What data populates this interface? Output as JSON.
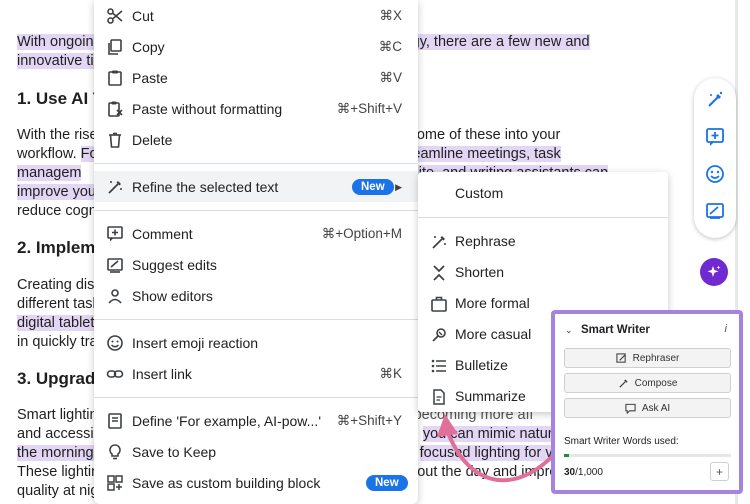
{
  "doc": {
    "line1a": "With ongoing",
    "line1b": "gy, there are a few new and",
    "line2": "innovative tip",
    "h1": "1. Use AI T",
    "p1_1a": "With the rise",
    "p1_1b": "some of these into your",
    "p1_2a": "workflow. ",
    "p1_2b": "Fo",
    "p1_2c": "reamline meetings, task",
    "p1_3a": "managem",
    "p1_3b": "site, and writing assistants can",
    "p1_4a": "improve you",
    "p1_5": "reduce cogn",
    "h2": "2. Impleme",
    "p2_1": "Creating dist",
    "p2_2": "different task",
    "p2_3": "digital tablet)",
    "p2_4": "in quickly tra",
    "h3": "3. Upgrad",
    "p3_1a": "Smart lightin",
    "p3_1b": "becoming more aff",
    "p3_2a": "and accessibl",
    "p3_2b": "you can mimic natural",
    "p3_3a": "the morning,",
    "p3_3b": "focused lighting for vid",
    "p3_4a": "These lightin",
    "p3_4b": "out the day and impro",
    "p3_5": "quality at nig"
  },
  "menu": {
    "cut": {
      "label": "Cut",
      "shortcut": "⌘X"
    },
    "copy": {
      "label": "Copy",
      "shortcut": "⌘C"
    },
    "paste": {
      "label": "Paste",
      "shortcut": "⌘V"
    },
    "paste_plain": {
      "label": "Paste without formatting",
      "shortcut": "⌘+Shift+V"
    },
    "delete": {
      "label": "Delete"
    },
    "refine": {
      "label": "Refine the selected text",
      "badge": "New"
    },
    "comment": {
      "label": "Comment",
      "shortcut": "⌘+Option+M"
    },
    "suggest": {
      "label": "Suggest edits"
    },
    "show_editors": {
      "label": "Show editors"
    },
    "emoji": {
      "label": "Insert emoji reaction"
    },
    "link": {
      "label": "Insert link",
      "shortcut": "⌘K"
    },
    "define": {
      "label": "Define 'For example, AI-pow...'",
      "shortcut": "⌘+Shift+Y"
    },
    "keep": {
      "label": "Save to Keep"
    },
    "building_block": {
      "label": "Save as custom building block",
      "badge": "New"
    }
  },
  "submenu": {
    "custom": "Custom",
    "rephrase": "Rephrase",
    "shorten": "Shorten",
    "formal": "More formal",
    "casual": "More casual",
    "bulletize": "Bulletize",
    "summarize": "Summarize"
  },
  "smart_writer": {
    "title": "Smart Writer",
    "info": "i",
    "rephraser": "Rephraser",
    "compose": "Compose",
    "ask_ai": "Ask AI",
    "words_used_label": "Smart Writer Words used:",
    "used": "30",
    "total": "/1,000",
    "usage_fraction": 0.03,
    "plus": "+"
  },
  "colors": {
    "highlight": "#e3d6f5",
    "badge": "#1a73e8",
    "panel_border": "#a683e0",
    "arrow": "#e0709a",
    "spark": "#6f2ad1"
  }
}
